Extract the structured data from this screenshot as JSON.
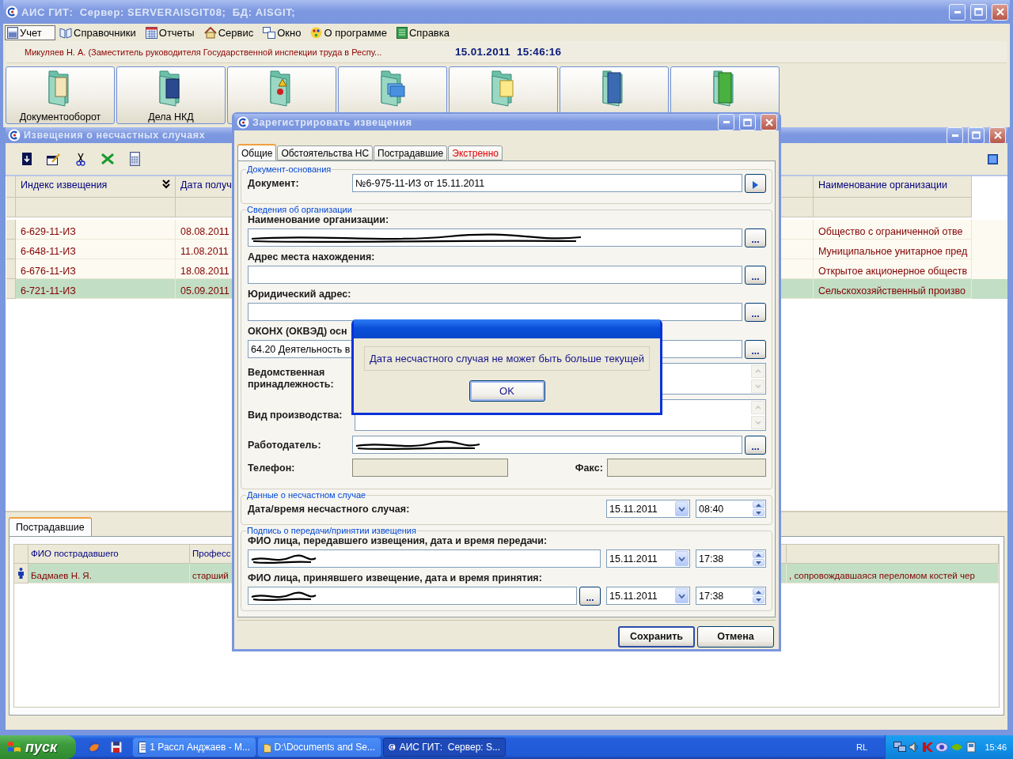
{
  "window": {
    "title": "АИС ГИТ:  Сервер: SERVERAISGIT08;  БД: AISGIT;"
  },
  "menu": [
    {
      "label": "Учет",
      "kind": "calculator",
      "selected": true
    },
    {
      "label": "Справочники",
      "kind": "books",
      "selected": false
    },
    {
      "label": "Отчеты",
      "kind": "calendar",
      "selected": false
    },
    {
      "label": "Сервис",
      "kind": "house",
      "selected": false
    },
    {
      "label": "Окно",
      "kind": "windows",
      "selected": false
    },
    {
      "label": "О программе",
      "kind": "palette",
      "selected": false
    },
    {
      "label": "Справка",
      "kind": "ledger",
      "selected": false
    }
  ],
  "info_bar": {
    "user": "Микуляев Н. А. (Заместитель руководителя Государственной инспекции труда в Респу...",
    "date": "15.01.2011",
    "time": "15:46:16"
  },
  "launchers": [
    {
      "label": "Документооборот",
      "kind": "documents"
    },
    {
      "label": "Дела НКД",
      "kind": "book"
    },
    {
      "kind": "warning"
    },
    {
      "kind": "contacts"
    },
    {
      "kind": "note"
    },
    {
      "kind": "binder"
    },
    {
      "kind": "green-binder"
    }
  ],
  "notices_window": {
    "title": "Извещения о несчастных случаях",
    "table": {
      "columns": [
        {
          "label": "Индекс извещения",
          "sort": true
        },
        {
          "label": "Дата получ"
        },
        {
          "label": "Наименование организации"
        }
      ],
      "rows": [
        {
          "cells": [
            "6-629-11-ИЗ",
            "08.08.2011",
            "Общество с ограниченной отве"
          ],
          "selected": false
        },
        {
          "cells": [
            "6-648-11-ИЗ",
            "11.08.2011",
            "Муниципальное унитарное пред"
          ],
          "selected": false
        },
        {
          "cells": [
            "6-676-11-ИЗ",
            "18.08.2011",
            "Открытое акционерное обществ"
          ],
          "selected": false
        },
        {
          "cells": [
            "6-721-11-ИЗ",
            "05.09.2011",
            "Сельскохозяйственный произво"
          ],
          "selected": true
        }
      ]
    }
  },
  "victims_panel": {
    "tab": "Пострадавшие",
    "columns": [
      "ФИО пострадавшего",
      "Професс"
    ],
    "rows": [
      {
        "cells": [
          "Бадмаев Н. Я.",
          "старший",
          ", сопровождавшаяся переломом костей чер"
        ],
        "selected": true
      }
    ]
  },
  "dialog": {
    "title": "Зарегистрировать извещения",
    "tabs": [
      {
        "label": "Общие",
        "selected": true,
        "alert": false
      },
      {
        "label": "Обстоятельства НС",
        "selected": false,
        "alert": false
      },
      {
        "label": "Пострадавшие",
        "selected": false,
        "alert": false
      },
      {
        "label": "Экстренно",
        "selected": false,
        "alert": true
      }
    ],
    "sections": [
      {
        "legend": "Документ-основания",
        "rows": [
          {
            "kind": "inline",
            "label": "Документ:",
            "value": "№6-975-11-ИЗ от 15.11.2011",
            "go": true
          }
        ]
      },
      {
        "legend": "Сведения об организации",
        "rows": [
          {
            "kind": "stacked",
            "label": "Наименование организации:",
            "redacted": true,
            "browse": "..."
          },
          {
            "kind": "stacked",
            "label": "Адрес места нахождения:",
            "browse": "..."
          },
          {
            "kind": "stacked",
            "label": "Юридический адрес:",
            "browse": "..."
          },
          {
            "kind": "stacked",
            "label": "ОКОНХ (ОКВЭД) осн",
            "value": "64.20 Деятельность в",
            "browse": "..."
          },
          {
            "kind": "memo",
            "label": "Ведомственная принадлежность:"
          },
          {
            "kind": "memo",
            "label": "Вид производства:"
          },
          {
            "kind": "inline",
            "label": "Работодатель:",
            "redacted": true,
            "browse": "..."
          },
          {
            "kind": "pair",
            "label": "Телефон:",
            "label_2": "Факс:",
            "disabled": true
          }
        ]
      },
      {
        "legend": "Данные о несчастном случае",
        "rows": [
          {
            "kind": "datetime",
            "label": "Дата/время несчастного случая:",
            "date": "15.11.2011",
            "time": "08:40"
          }
        ]
      },
      {
        "legend": "Подпись о передачи/принятии извещения",
        "rows": [
          {
            "kind": "stacked-datetime",
            "label": "ФИО лица, передавшего извещения, дата и время передачи:",
            "redacted": true,
            "date": "15.11.2011",
            "time": "17:38"
          },
          {
            "kind": "stacked-datetime",
            "label": "ФИО лица, принявшего извещение, дата и время принятия:",
            "redacted": true,
            "browse": "...",
            "date": "15.11.2011",
            "time": "17:38"
          }
        ]
      }
    ],
    "buttons": [
      {
        "label": "Сохранить",
        "default": true
      },
      {
        "label": "Отмена",
        "default": false
      }
    ]
  },
  "message_box": {
    "message": "Дата несчастного случая не может быть больше текущей",
    "button": "OK"
  },
  "taskbar": {
    "start": "пуск",
    "tasks": [
      {
        "label": "1 Рассл Анджаев - М...",
        "kind": "document",
        "selected": false
      },
      {
        "label": "D:\\Documents and Se...",
        "kind": "folder",
        "selected": false
      },
      {
        "label": "АИС ГИТ:  Сервер: S...",
        "kind": "app",
        "selected": true
      }
    ],
    "language": "RL",
    "clock": "15:46"
  }
}
